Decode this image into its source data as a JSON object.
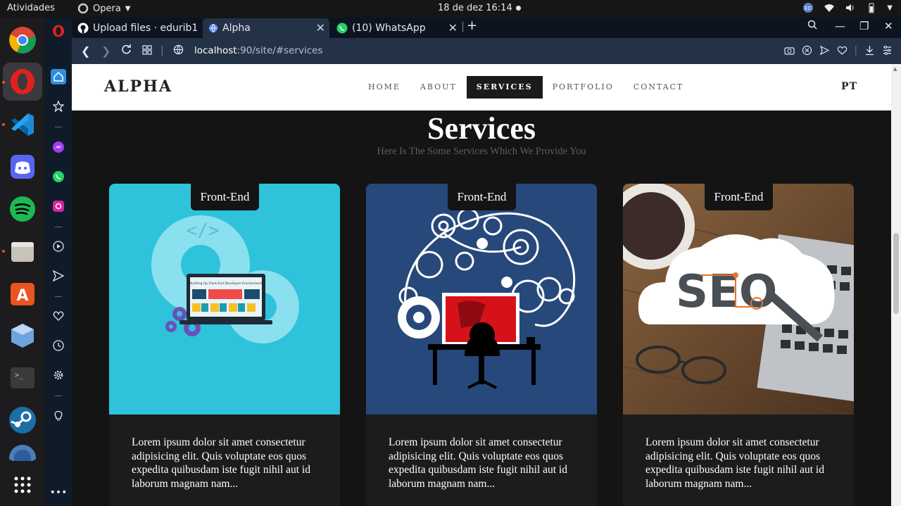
{
  "topbar": {
    "activities": "Atividades",
    "app_name": "Opera",
    "clock": "18 de dez  16:14",
    "tray_icons": [
      "user-badge-icon",
      "wifi-icon",
      "volume-icon",
      "battery-icon",
      "power-menu-icon"
    ]
  },
  "dock": {
    "apps": [
      "chrome-icon",
      "opera-icon",
      "vscode-icon",
      "discord-icon",
      "spotify-icon",
      "files-icon",
      "software-center-icon",
      "virtualbox-icon",
      "terminal-icon",
      "steam-icon",
      "app-icon",
      "show-apps-icon"
    ]
  },
  "sidebar": {
    "items": [
      "opera-logo-icon",
      "home-icon",
      "star-icon",
      "messenger-icon",
      "whatsapp-icon",
      "instagram-icon",
      "player-icon",
      "send-icon",
      "heart-icon",
      "history-icon",
      "settings-icon",
      "bulb-icon",
      "more-icon"
    ]
  },
  "tabs": [
    {
      "label": "Upload files · edurib1",
      "icon": "github-icon"
    },
    {
      "label": "Alpha",
      "icon": "globe-icon"
    },
    {
      "label": "(10) WhatsApp",
      "icon": "whatsapp-icon"
    }
  ],
  "address": {
    "host": "localhost",
    "path": ":90/site/#services"
  },
  "site": {
    "brand": "ALPHA",
    "menu": [
      "HOME",
      "ABOUT",
      "SERVICES",
      "PORTFOLIO",
      "CONTACT"
    ],
    "active_menu": "SERVICES",
    "lang": "PT",
    "title": "Services",
    "subtitle": "Here Is The Some Services Which We Provide You",
    "cards": [
      {
        "label": "Front-End",
        "text": "Lorem ipsum dolor sit amet consectetur adipisicing elit. Quis voluptate eos quos expedita quibusdam iste fugit nihil aut id laborum magnam nam...",
        "image": "developer-laptop-gears-illustration",
        "image_text": "Building Up Front-End Developer Environment",
        "bg": "#2ec3db"
      },
      {
        "label": "Front-End",
        "text": "Lorem ipsum dolor sit amet consectetur adipisicing elit. Quis voluptate eos quos expedita quibusdam iste fugit nihil aut id laborum magnam nam...",
        "image": "programmer-gears-illustration",
        "bg": "#27487a"
      },
      {
        "label": "Front-End",
        "text": "Lorem ipsum dolor sit amet consectetur adipisicing elit. Quis voluptate eos quos expedita quibusdam iste fugit nihil aut id laborum magnam nam...",
        "image": "seo-cloud-desk-photo",
        "image_text": "SEO",
        "bg": "#6b4a2f"
      }
    ]
  },
  "colors": {
    "page_bg": "#141414",
    "nav_bg": "#ffffff",
    "browser_chrome": "#243247",
    "accent_red": "#e1211c"
  }
}
